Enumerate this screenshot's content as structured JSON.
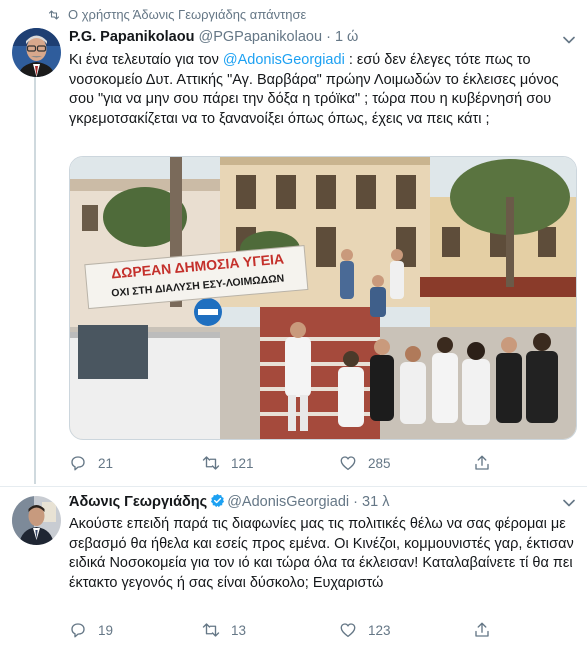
{
  "context": {
    "text": "Ο χρήστης Άδωνις Γεωργιάδης απάντησε",
    "icon": "retweet-icon"
  },
  "tweets": [
    {
      "name": "P.G. Papanikolaou",
      "handle": "@PGPapanikolaou",
      "separator": "·",
      "time": "1 ώ",
      "verified": false,
      "text_before": "Κι ένα τελευταίο για τον ",
      "mention": "@AdonisGeorgiadi",
      "text_after": " : εσύ δεν έλεγες τότε πως το νοσοκομείο Δυτ. Αττικής \"Αγ. Βαρβάρα\" πρώην Λοιμωδών το έκλεισες μόνος σου \"για να μην σου πάρει την δόξα η τρόϊκα\" ; τώρα που η κυβέρνησή σου γκρεμοτσακίζεται να το ξανανοίξει όπως όπως, έχεις να πεις κάτι ;",
      "image": {
        "banner_line1": "ΔΩΡΕΑΝ ΔΗΜΟΣΙΑ ΥΓΕΙΑ",
        "banner_line2": "ΟΧΙ ΣΤΗ ΔΙΑΛΥΣΗ ΕΣΥ-ΛΟΙΜΩΔΩΝ"
      },
      "replies": "21",
      "retweets": "121",
      "likes": "285"
    },
    {
      "name": "Άδωνις Γεωργιάδης",
      "handle": "@AdonisGeorgiadi",
      "separator": "·",
      "time": "31 λ",
      "verified": true,
      "text": "Ακούστε επειδή παρά τις διαφωνίες μας τις πολιτικές θέλω να σας φέρομαι με σεβασμό θα ήθελα και εσείς προς εμένα. Οι Κινέζοι, κομμουνιστές γαρ, έκτισαν ειδικά Νοσοκομεία για τον ιό και τώρα όλα τα έκλεισαν! Καταλαβαίνετε τί θα πει έκτακτο γεγονός ή σας είναι δύσκολο; Ευχαριστώ",
      "replies": "19",
      "retweets": "13",
      "likes": "123"
    }
  ],
  "icons": {
    "reply": "reply-icon",
    "retweet": "retweet-icon",
    "like": "like-icon",
    "share": "share-icon",
    "more": "chevron-down-icon",
    "verified": "verified-badge-icon"
  },
  "colors": {
    "accent": "#1da1f2",
    "secondary_text": "#657786",
    "primary_text": "#14171a",
    "border": "#e6ecf0"
  }
}
